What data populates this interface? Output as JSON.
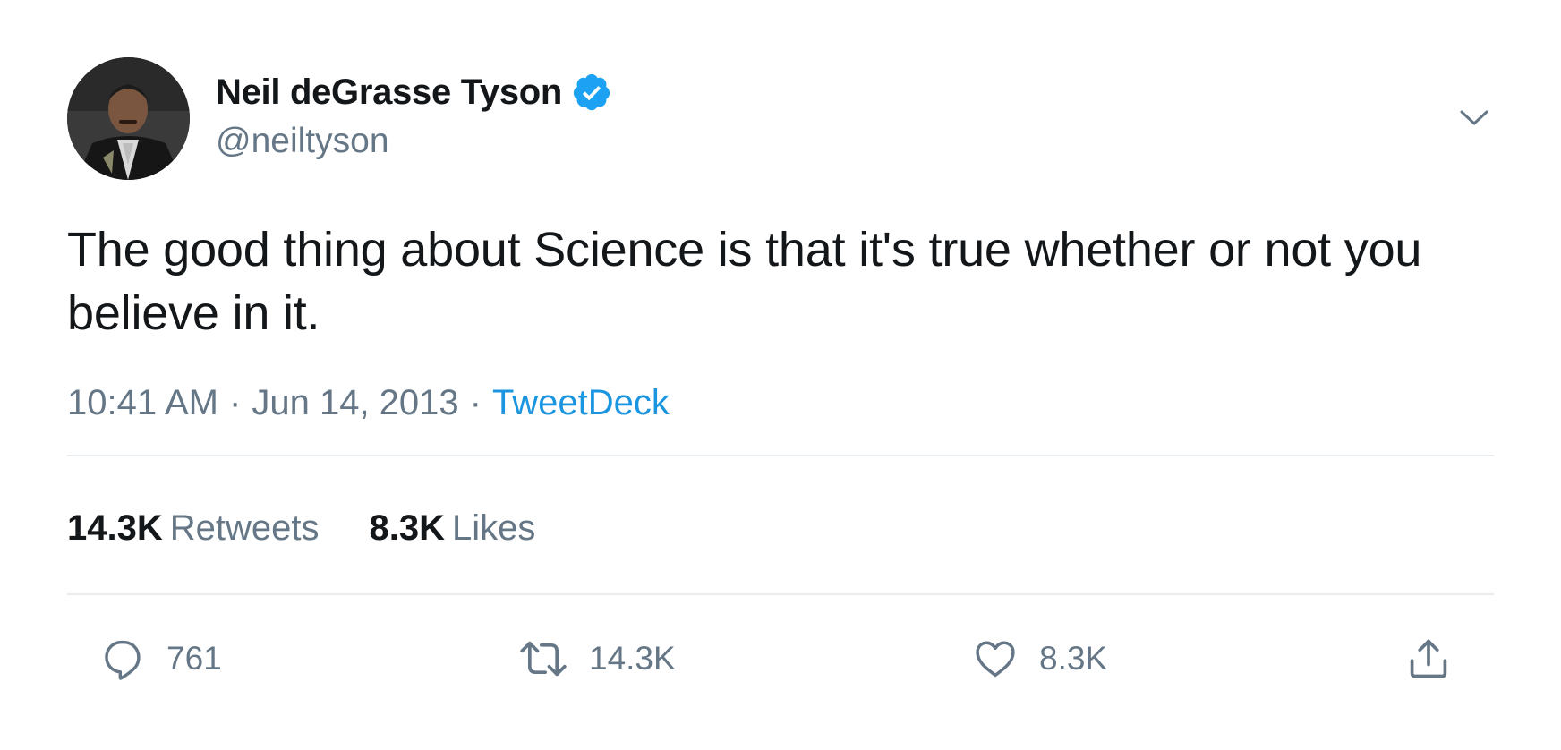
{
  "user": {
    "display_name": "Neil deGrasse Tyson",
    "handle": "@neiltyson",
    "verified": true
  },
  "tweet": {
    "text": "The good thing about Science is that it's true whether or not you believe in it.",
    "time": "10:41 AM",
    "date": "Jun 14, 2013",
    "source": "TweetDeck"
  },
  "stats": {
    "retweets_count": "14.3K",
    "retweets_label": "Retweets",
    "likes_count": "8.3K",
    "likes_label": "Likes"
  },
  "actions": {
    "reply_count": "761",
    "retweet_count": "14.3K",
    "like_count": "8.3K"
  },
  "icons": {
    "verified": "verified-badge-icon",
    "caret": "chevron-down-icon",
    "reply": "reply-bubble-icon",
    "retweet": "retweet-arrows-icon",
    "like": "heart-icon",
    "share": "share-upload-icon"
  },
  "colors": {
    "text": "#14171a",
    "secondary": "#657786",
    "link": "#1b95e0",
    "verified": "#1da1f2",
    "divider": "#e6ecf0"
  }
}
